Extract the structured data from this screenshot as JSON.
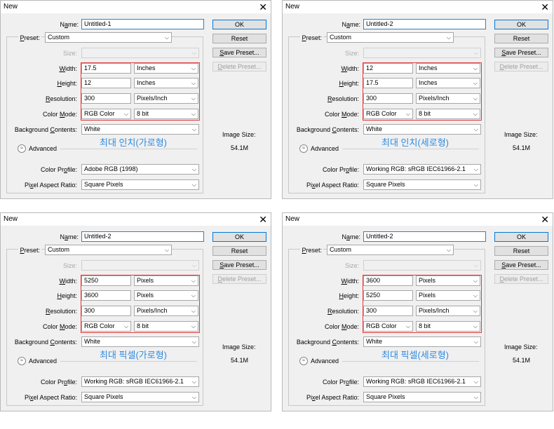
{
  "dialogs": [
    {
      "title": "New",
      "name": "Untitled-1",
      "preset": "Custom",
      "size_label": "Size:",
      "width": "17.5",
      "width_unit": "Inches",
      "height": "12",
      "height_unit": "Inches",
      "resolution": "300",
      "resolution_unit": "Pixels/Inch",
      "color_mode": "RGB Color",
      "bit_depth": "8 bit",
      "background": "White",
      "color_profile": "Adobe RGB (1998)",
      "pixel_aspect": "Square Pixels",
      "annotation": "최대 인치(가로형)",
      "image_size": "54.1M"
    },
    {
      "title": "New",
      "name": "Untitled-2",
      "preset": "Custom",
      "size_label": "Size:",
      "width": "12",
      "width_unit": "Inches",
      "height": "17.5",
      "height_unit": "Inches",
      "resolution": "300",
      "resolution_unit": "Pixels/Inch",
      "color_mode": "RGB Color",
      "bit_depth": "8 bit",
      "background": "White",
      "color_profile": "Working RGB:  sRGB IEC61966-2.1",
      "pixel_aspect": "Square Pixels",
      "annotation": "최대 인치(세로형)",
      "image_size": "54.1M"
    },
    {
      "title": "New",
      "name": "Untitled-2",
      "preset": "Custom",
      "size_label": "Size:",
      "width": "5250",
      "width_unit": "Pixels",
      "height": "3600",
      "height_unit": "Pixels",
      "resolution": "300",
      "resolution_unit": "Pixels/Inch",
      "color_mode": "RGB Color",
      "bit_depth": "8 bit",
      "background": "White",
      "color_profile": "Working RGB:  sRGB IEC61966-2.1",
      "pixel_aspect": "Square Pixels",
      "annotation": "최대 픽셀(가로형)",
      "image_size": "54.1M"
    },
    {
      "title": "New",
      "name": "Untitled-2",
      "preset": "Custom",
      "size_label": "Size:",
      "width": "3600",
      "width_unit": "Pixels",
      "height": "5250",
      "height_unit": "Pixels",
      "resolution": "300",
      "resolution_unit": "Pixels/Inch",
      "color_mode": "RGB Color",
      "bit_depth": "8 bit",
      "background": "White",
      "color_profile": "Working RGB:  sRGB IEC61966-2.1",
      "pixel_aspect": "Square Pixels",
      "annotation": "최대 픽셀(세로형)",
      "image_size": "54.1M"
    }
  ],
  "labels": {
    "close": "✕",
    "name_pre": "N",
    "name_ul": "a",
    "name_post": "me:",
    "preset_pre": "",
    "preset_ul": "P",
    "preset_post": "reset:",
    "width_pre": "",
    "width_ul": "W",
    "width_post": "idth:",
    "height_pre": "",
    "height_ul": "H",
    "height_post": "eight:",
    "res_pre": "",
    "res_ul": "R",
    "res_post": "esolution:",
    "mode_pre": "Color ",
    "mode_ul": "M",
    "mode_post": "ode:",
    "bg_pre": "Background ",
    "bg_ul": "C",
    "bg_post": "ontents:",
    "advanced": "Advanced",
    "profile_pre": "Color Pr",
    "profile_ul": "o",
    "profile_post": "file:",
    "aspect_pre": "Pi",
    "aspect_ul": "x",
    "aspect_post": "el Aspect Ratio:",
    "image_size": "Image Size:",
    "advanced_icon_glyph": "≈",
    "chevron_glyph": "⌵"
  },
  "buttons": {
    "ok": "OK",
    "reset": "Reset",
    "save_pre": "",
    "save_ul": "S",
    "save_post": "ave Preset...",
    "delete_pre": "",
    "delete_ul": "D",
    "delete_post": "elete Preset..."
  },
  "colors": {
    "annotation": "#2e8be0",
    "highlight_box": "#e03a3a",
    "default_button_border": "#0078d7"
  }
}
